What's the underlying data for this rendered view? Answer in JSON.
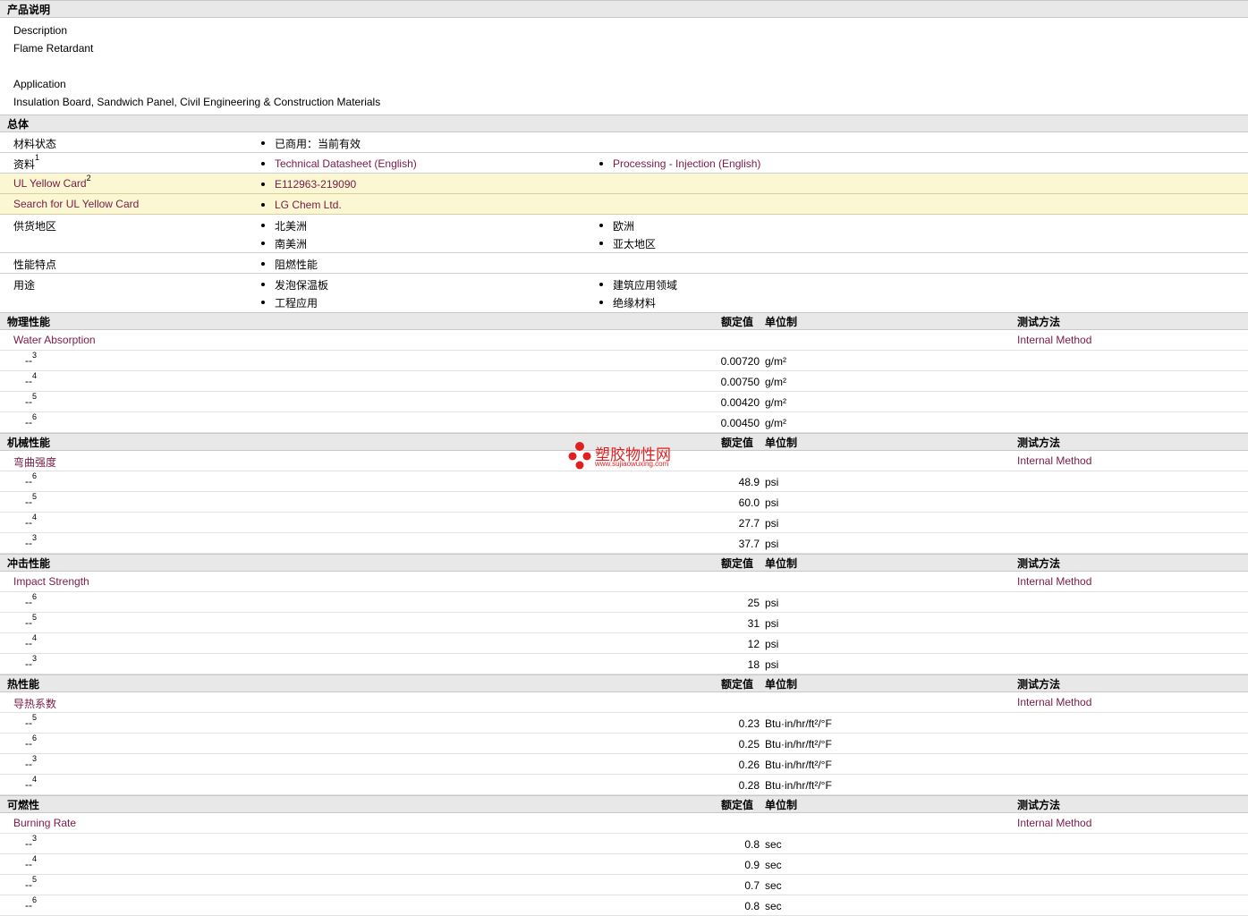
{
  "sections": {
    "product": "产品说明",
    "general": "总体",
    "physical": "物理性能",
    "mechanical": "机械性能",
    "impact": "冲击性能",
    "thermal": "热性能",
    "flammability": "可燃性"
  },
  "col_headers": {
    "value": "额定值",
    "unit": "单位制",
    "method": "测试方法"
  },
  "description": {
    "label": "Description",
    "text": "Flame Retardant",
    "app_label": "Application",
    "app_text": "Insulation Board, Sandwich Panel, Civil Engineering & Construction Materials"
  },
  "general": {
    "status_label": "材料状态",
    "status_value": "已商用：当前有效",
    "docs_label": "资料",
    "docs_sup": "1",
    "doc1": "Technical Datasheet (English)",
    "doc2": "Processing - Injection (English)",
    "ul_label": "UL Yellow Card",
    "ul_sup": "2",
    "ul_value": "E112963-219090",
    "search_label": "Search for UL Yellow Card",
    "search_value": "LG Chem Ltd.",
    "region_label": "供货地区",
    "regions": [
      "北美洲",
      "欧洲",
      "南美洲",
      "亚太地区"
    ],
    "feature_label": "性能特点",
    "feature_value": "阻燃性能",
    "use_label": "用途",
    "uses": [
      "发泡保温板",
      "建筑应用领域",
      "工程应用",
      "绝缘材料"
    ]
  },
  "properties": {
    "water": {
      "name": "Water Absorption",
      "method": "Internal Method",
      "rows": [
        {
          "sub": "3",
          "value": "0.00720",
          "unit": "g/m²"
        },
        {
          "sub": "4",
          "value": "0.00750",
          "unit": "g/m²"
        },
        {
          "sub": "5",
          "value": "0.00420",
          "unit": "g/m²"
        },
        {
          "sub": "6",
          "value": "0.00450",
          "unit": "g/m²"
        }
      ]
    },
    "flex": {
      "name": "弯曲强度",
      "method": "Internal Method",
      "rows": [
        {
          "sub": "6",
          "value": "48.9",
          "unit": "psi"
        },
        {
          "sub": "5",
          "value": "60.0",
          "unit": "psi"
        },
        {
          "sub": "4",
          "value": "27.7",
          "unit": "psi"
        },
        {
          "sub": "3",
          "value": "37.7",
          "unit": "psi"
        }
      ]
    },
    "impact": {
      "name": "Impact Strength",
      "method": "Internal Method",
      "rows": [
        {
          "sub": "6",
          "value": "25",
          "unit": "psi"
        },
        {
          "sub": "5",
          "value": "31",
          "unit": "psi"
        },
        {
          "sub": "4",
          "value": "12",
          "unit": "psi"
        },
        {
          "sub": "3",
          "value": "18",
          "unit": "psi"
        }
      ]
    },
    "thermal": {
      "name": "导热系数",
      "method": "Internal Method",
      "rows": [
        {
          "sub": "5",
          "value": "0.23",
          "unit": "Btu·in/hr/ft²/°F"
        },
        {
          "sub": "6",
          "value": "0.25",
          "unit": "Btu·in/hr/ft²/°F"
        },
        {
          "sub": "3",
          "value": "0.26",
          "unit": "Btu·in/hr/ft²/°F"
        },
        {
          "sub": "4",
          "value": "0.28",
          "unit": "Btu·in/hr/ft²/°F"
        }
      ]
    },
    "burn": {
      "name": "Burning Rate",
      "method": "Internal Method",
      "rows": [
        {
          "sub": "3",
          "value": "0.8",
          "unit": "sec"
        },
        {
          "sub": "4",
          "value": "0.9",
          "unit": "sec"
        },
        {
          "sub": "5",
          "value": "0.7",
          "unit": "sec"
        },
        {
          "sub": "6",
          "value": "0.8",
          "unit": "sec"
        }
      ]
    }
  },
  "watermark": {
    "title": "塑胶物性网",
    "url": "www.sujiaowuxing.com"
  }
}
